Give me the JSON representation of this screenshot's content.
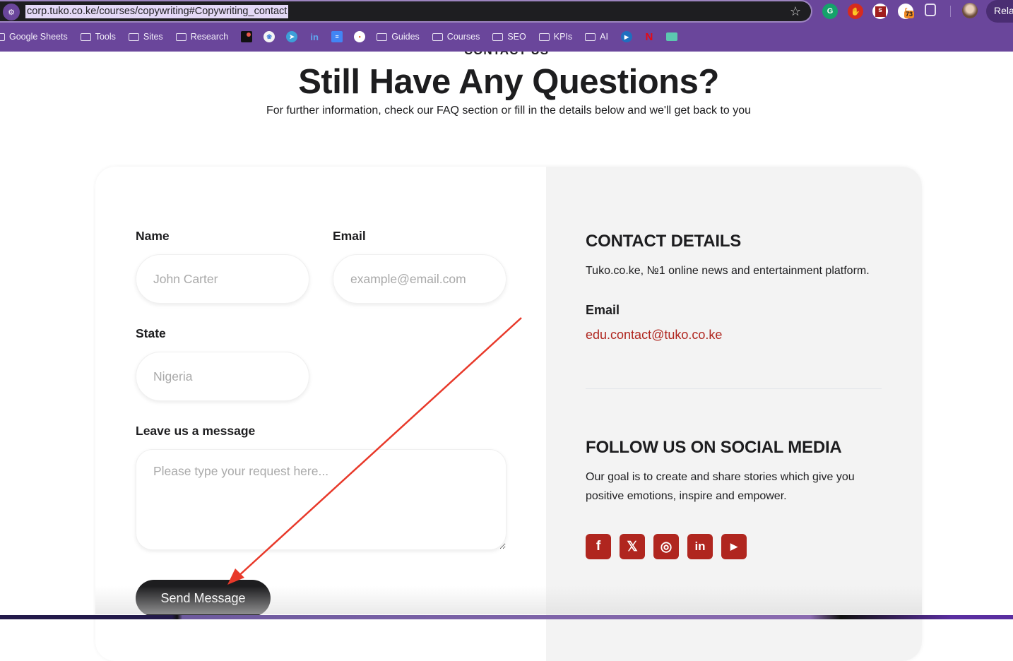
{
  "browser": {
    "url": "corp.tuko.co.ke/courses/copywriting#Copywriting_contact",
    "relaunch_label": "Rela",
    "extension_badge_count": "73",
    "extensions": [
      "grammarly-icon",
      "adblock-icon",
      "s-extension-icon",
      "rss-extension-icon",
      "puzzle-extensions-icon"
    ],
    "bookmarks": [
      {
        "type": "folder",
        "label": "Google Sheets"
      },
      {
        "type": "folder",
        "label": "Tools"
      },
      {
        "type": "folder",
        "label": "Sites"
      },
      {
        "type": "folder",
        "label": "Research"
      },
      {
        "type": "icon",
        "icon": "notion-style-icon"
      },
      {
        "type": "icon",
        "icon": "colorful-logo-icon"
      },
      {
        "type": "icon",
        "icon": "telegram-icon"
      },
      {
        "type": "icon",
        "icon": "linkedin-icon"
      },
      {
        "type": "icon",
        "icon": "google-docs-icon"
      },
      {
        "type": "icon",
        "icon": "circle-site-icon"
      },
      {
        "type": "folder",
        "label": "Guides"
      },
      {
        "type": "folder",
        "label": "Courses"
      },
      {
        "type": "folder",
        "label": "SEO"
      },
      {
        "type": "folder",
        "label": "KPIs"
      },
      {
        "type": "folder",
        "label": "AI"
      },
      {
        "type": "icon",
        "icon": "play-icon"
      },
      {
        "type": "icon",
        "icon": "netflix-icon"
      },
      {
        "type": "icon",
        "icon": "teal-m-icon"
      }
    ]
  },
  "page": {
    "eyebrow": "CONTACT US",
    "title": "Still Have Any Questions?",
    "subtitle": "For further information, check our FAQ section or fill in the details below and we'll get back to you"
  },
  "form": {
    "name_label": "Name",
    "name_placeholder": "John Carter",
    "email_label": "Email",
    "email_placeholder": "example@email.com",
    "state_label": "State",
    "state_placeholder": "Nigeria",
    "message_label": "Leave us a message",
    "message_placeholder": "Please type your request here...",
    "submit_label": "Send Message"
  },
  "contact": {
    "heading": "CONTACT DETAILS",
    "description": "Tuko.co.ke, №1 online news and entertainment platform.",
    "email_label": "Email",
    "email_value": "edu.contact@tuko.co.ke",
    "social_heading": "FOLLOW US ON SOCIAL MEDIA",
    "social_description": "Our goal is to create and share stories which give you positive emotions, inspire and empower.",
    "socials": [
      {
        "name": "facebook",
        "glyph": "f"
      },
      {
        "name": "x-twitter",
        "glyph": "𝕏"
      },
      {
        "name": "instagram",
        "glyph": "◎"
      },
      {
        "name": "linkedin",
        "glyph": "in"
      },
      {
        "name": "youtube",
        "glyph": "▶"
      }
    ]
  },
  "colors": {
    "browser_purple": "#6a469b",
    "accent_red": "#b0261f",
    "annotation_arrow": "#e8392a"
  }
}
